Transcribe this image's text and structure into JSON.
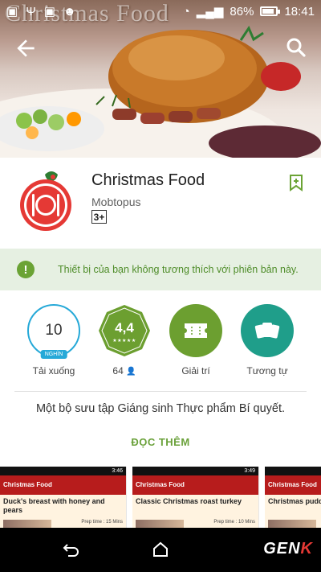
{
  "status_bar": {
    "battery": "86%",
    "time": "18:41",
    "icons": [
      "image-icon",
      "usb-icon",
      "image-icon",
      "android-icon",
      "wifi-icon",
      "signal-icon",
      "battery-icon"
    ]
  },
  "hero": {
    "watermark": "Christmas Food",
    "back_icon": "arrow-back-icon",
    "search_icon": "search-icon"
  },
  "app": {
    "title": "Christmas Food",
    "developer": "Mobtopus",
    "age_rating": "3+",
    "wishlist_icon": "bookmark-add-icon"
  },
  "warning": {
    "icon": "!",
    "text": "Thiết bị của bạn không tương thích với phiên bản này."
  },
  "stats": {
    "downloads": {
      "value": "10",
      "unit": "NGHÌN",
      "label": "Tải xuống"
    },
    "rating": {
      "value": "4,4",
      "stars": "★★★★★",
      "count": "64"
    },
    "category": {
      "label": "Giải trí",
      "icon": "ticket-icon"
    },
    "similar": {
      "label": "Tương tự",
      "icon": "cards-icon"
    }
  },
  "description": "Một bộ sưu tập Giáng sinh Thực phẩm Bí quyết.",
  "read_more": "ĐỌC THÊM",
  "screenshots": [
    {
      "time": "3:46",
      "app_bar": "Christmas Food",
      "title": "Duck's breast with honey and pears",
      "prep": "Prep time : 15 Mins"
    },
    {
      "time": "3:49",
      "app_bar": "Christmas Food",
      "title": "Classic Christmas roast turkey",
      "prep": "Prep time : 10 Mins"
    },
    {
      "time": "",
      "app_bar": "Christmas Food",
      "title": "Christmas pudd",
      "prep": ""
    }
  ],
  "nav": {
    "back_icon": "back-icon",
    "home_icon": "home-icon",
    "brand": "GENK",
    "brand_main": "GEN",
    "brand_accent": "K"
  },
  "colors": {
    "accent_green": "#6ba335",
    "download_blue": "#26a9d8",
    "category_green": "#6c9f30",
    "similar_teal": "#1f9e8a",
    "warning_bg": "#e6f0e2",
    "screenshot_bar": "#b71c1c"
  }
}
